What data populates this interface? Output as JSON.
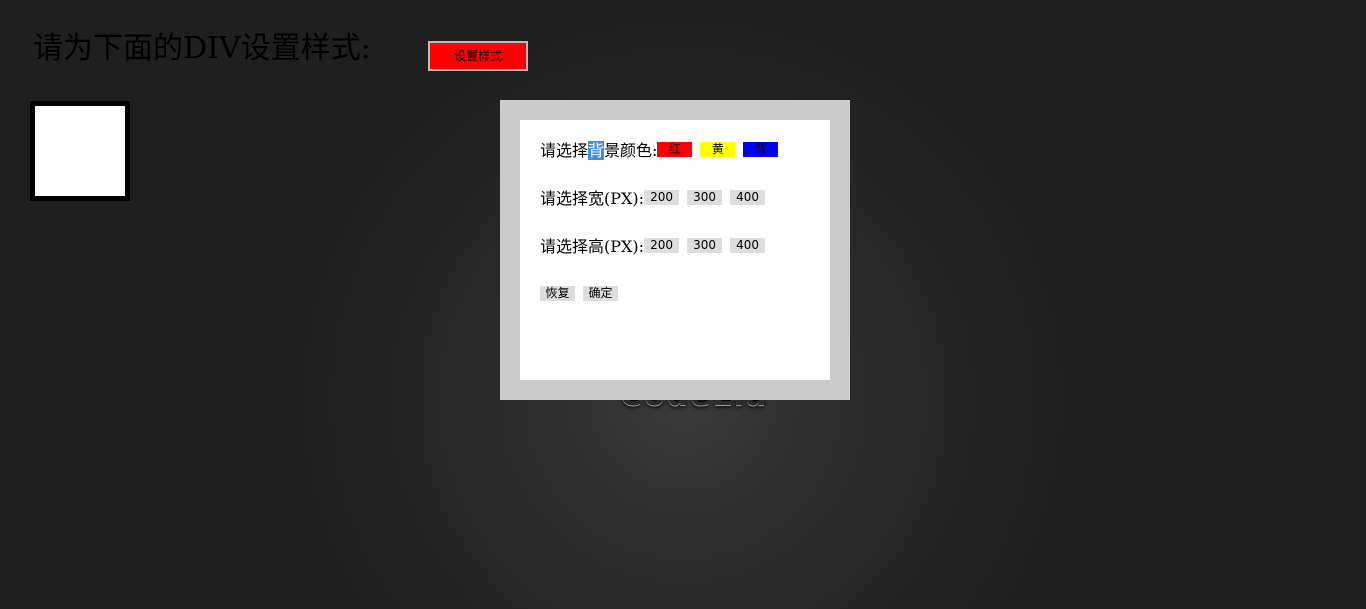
{
  "heading": "请为下面的DIV设置样式:",
  "set_style_button": "设置样式",
  "watermark": "CodeLia",
  "dialog": {
    "bg_label_before": "请选择",
    "bg_label_highlight": "背",
    "bg_label_after": "景颜色:",
    "bg_options": [
      "红",
      "黄",
      "蓝"
    ],
    "width_label": "请选择宽(PX):",
    "width_options": [
      "200",
      "300",
      "400"
    ],
    "height_label": "请选择高(PX):",
    "height_options": [
      "200",
      "300",
      "400"
    ],
    "reset_button": "恢复",
    "confirm_button": "确定"
  },
  "colors": {
    "red": "#ff0000",
    "yellow": "#ffff00",
    "blue": "#0000ff",
    "dialog_frame": "#cccccc",
    "option_gray": "#dddddd",
    "selection_highlight": "#3d8ee6"
  }
}
